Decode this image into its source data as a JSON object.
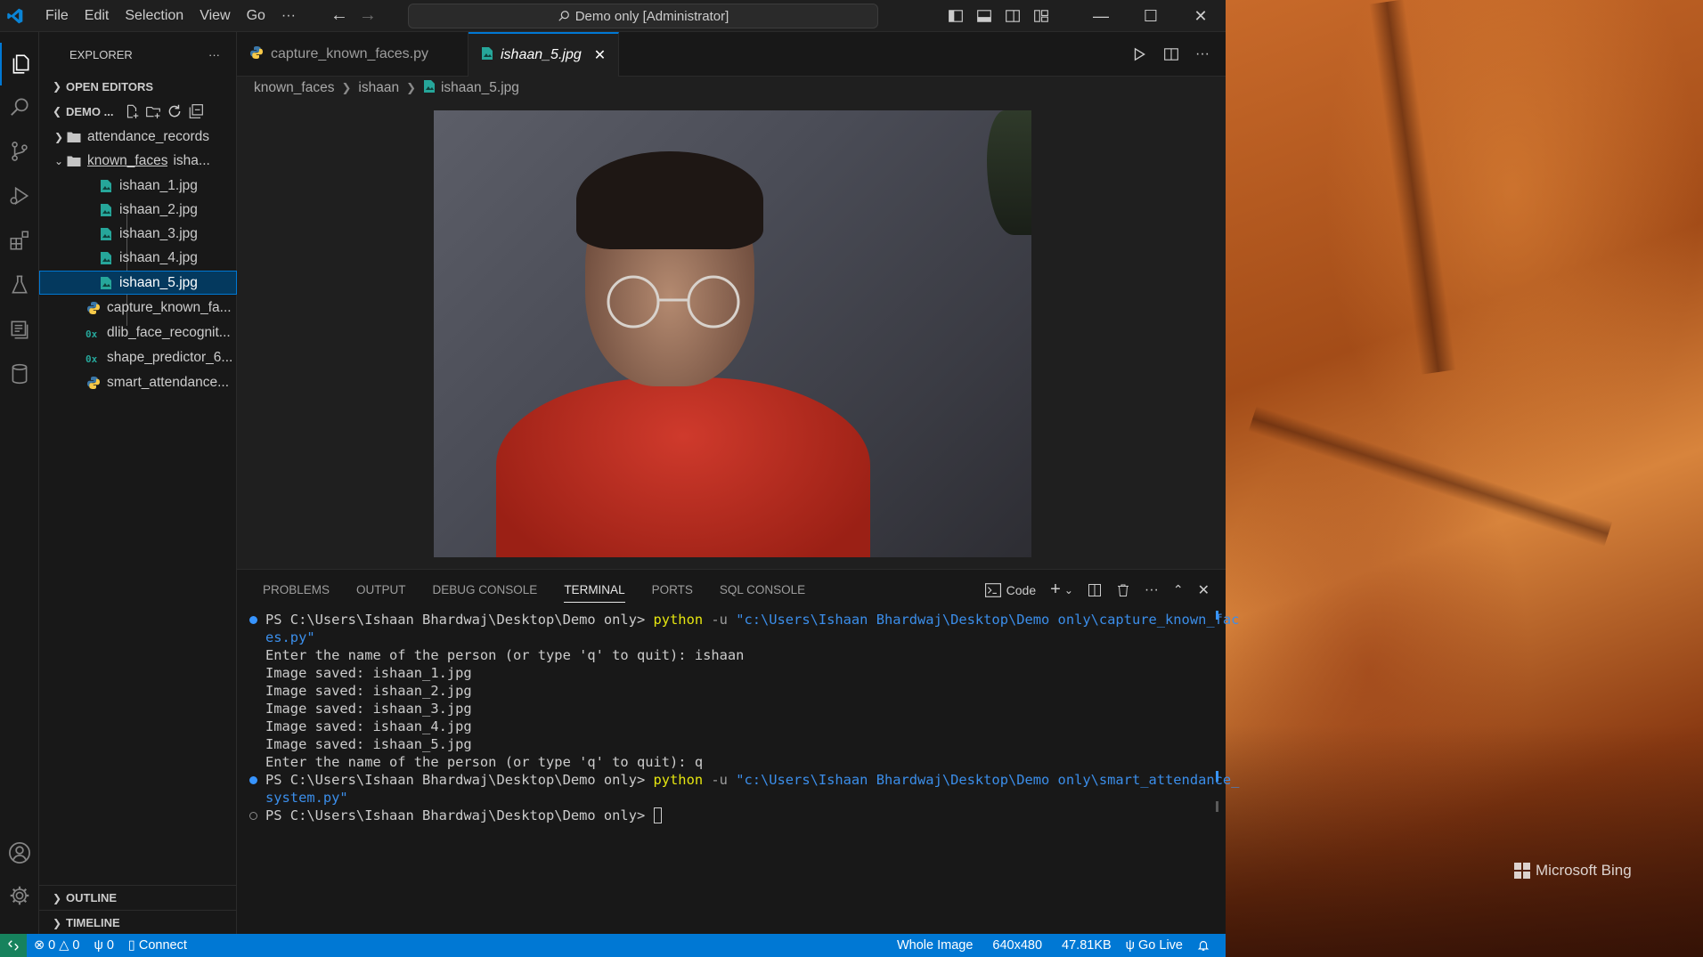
{
  "app": {
    "command_center": "Demo only [Administrator]",
    "menu": [
      "File",
      "Edit",
      "Selection",
      "View",
      "Go",
      "···"
    ]
  },
  "explorer": {
    "title": "EXPLORER",
    "more": "···",
    "open_editors": "OPEN EDITORS",
    "workspace": "DEMO ...",
    "tree": {
      "attendance_records": "attendance_records",
      "known_faces": "known_faces",
      "known_faces_suffix": "isha...",
      "files": [
        "ishaan_1.jpg",
        "ishaan_2.jpg",
        "ishaan_3.jpg",
        "ishaan_4.jpg",
        "ishaan_5.jpg"
      ],
      "capture": "capture_known_fa...",
      "dlib": "dlib_face_recognit...",
      "shape": "shape_predictor_6...",
      "smart": "smart_attendance..."
    },
    "outline": "OUTLINE",
    "timeline": "TIMELINE"
  },
  "tabs": {
    "tab1": "capture_known_faces.py",
    "tab2": "ishaan_5.jpg"
  },
  "breadcrumb": {
    "part1": "known_faces",
    "part2": "ishaan",
    "part3": "ishaan_5.jpg"
  },
  "panel": {
    "tabs": {
      "problems": "PROBLEMS",
      "output": "OUTPUT",
      "debug": "DEBUG CONSOLE",
      "terminal": "TERMINAL",
      "ports": "PORTS",
      "sql": "SQL CONSOLE"
    },
    "profile": "Code"
  },
  "terminal": {
    "l1_prompt": "PS C:\\Users\\Ishaan Bhardwaj\\Desktop\\Demo only> ",
    "l1_cmd": "python",
    "l1_flag": " -u ",
    "l1_str_a": "\"c:\\Users\\Ishaan Bhardwaj\\Desktop\\Demo only\\capture_known_fac",
    "l1_str_b": "es.py\"",
    "l2": "Enter the name of the person (or type 'q' to quit): ishaan",
    "l3": "Image saved: ishaan_1.jpg",
    "l4": "Image saved: ishaan_2.jpg",
    "l5": "Image saved: ishaan_3.jpg",
    "l6": "Image saved: ishaan_4.jpg",
    "l7": "Image saved: ishaan_5.jpg",
    "l8": "Enter the name of the person (or type 'q' to quit): q",
    "l9_prompt": "PS C:\\Users\\Ishaan Bhardwaj\\Desktop\\Demo only> ",
    "l9_cmd": "python",
    "l9_flag": " -u ",
    "l9_str_a": "\"c:\\Users\\Ishaan Bhardwaj\\Desktop\\Demo only\\smart_attendance_",
    "l9_str_b": "system.py\"",
    "l10_prompt": "PS C:\\Users\\Ishaan Bhardwaj\\Desktop\\Demo only> "
  },
  "status": {
    "errors": "0",
    "warnings": "0",
    "ports": "0",
    "connect": "Connect",
    "whole_image": "Whole Image",
    "dimensions": "640x480",
    "size": "47.81KB",
    "go_live": "Go Live"
  },
  "wallpaper": {
    "brand": "Microsoft Bing"
  },
  "colors": {
    "accent": "#0078d4",
    "remote": "#16825d",
    "command_yellow": "#e5e510",
    "string_blue": "#3b8eea"
  }
}
